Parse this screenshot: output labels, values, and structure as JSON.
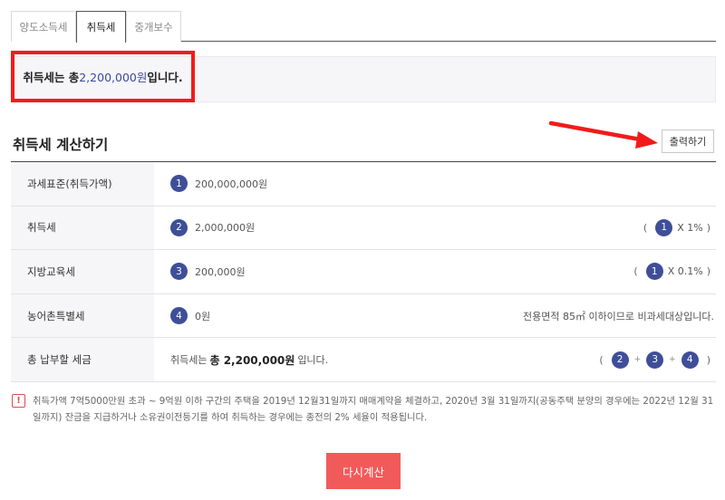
{
  "tabs": [
    "양도소득세",
    "취득세",
    "중개보수"
  ],
  "result": {
    "prefix": "취득세는 총 ",
    "amount": "2,200,000원",
    "suffix": " 입니다."
  },
  "section": {
    "title": "취득세 계산하기",
    "print_label": "출력하기"
  },
  "rows": [
    {
      "label": "과세표준(취득가액)",
      "num": "1",
      "value": "200,000,000원",
      "formula": ""
    },
    {
      "label": "취득세",
      "num": "2",
      "value": "2,000,000원",
      "formula_num": "1",
      "formula_text": "X  1%"
    },
    {
      "label": "지방교육세",
      "num": "3",
      "value": "200,000원",
      "formula_num": "1",
      "formula_text": "X  0.1%"
    },
    {
      "label": "농어촌특별세",
      "num": "4",
      "value": "0원",
      "note": "전용면적 85㎡ 이하이므로 비과세대상입니다."
    }
  ],
  "total": {
    "label": "총 납부할 세금",
    "prefix": "취득세는",
    "amount": "총 2,200,000원",
    "suffix": "입니다.",
    "nums": [
      "2",
      "3",
      "4"
    ],
    "op": "+"
  },
  "notice": {
    "icon": "!",
    "text": "취득가액 7억5000만원 초과 ~ 9억원 이하 구간의 주택을 2019년 12월31일까지 매매계약을 체결하고, 2020년 3월 31일까지(공동주택 분양의 경우에는 2022년 12월 31일까지) 잔금을 지급하거나 소유권이전등기를 하여 취득하는 경우에는 종전의 2% 세율이 적용됩니다."
  },
  "recalc_label": "다시계산",
  "colors": {
    "accent": "#3e4f98",
    "highlight": "#f21b1b",
    "button": "#f25a5a"
  }
}
